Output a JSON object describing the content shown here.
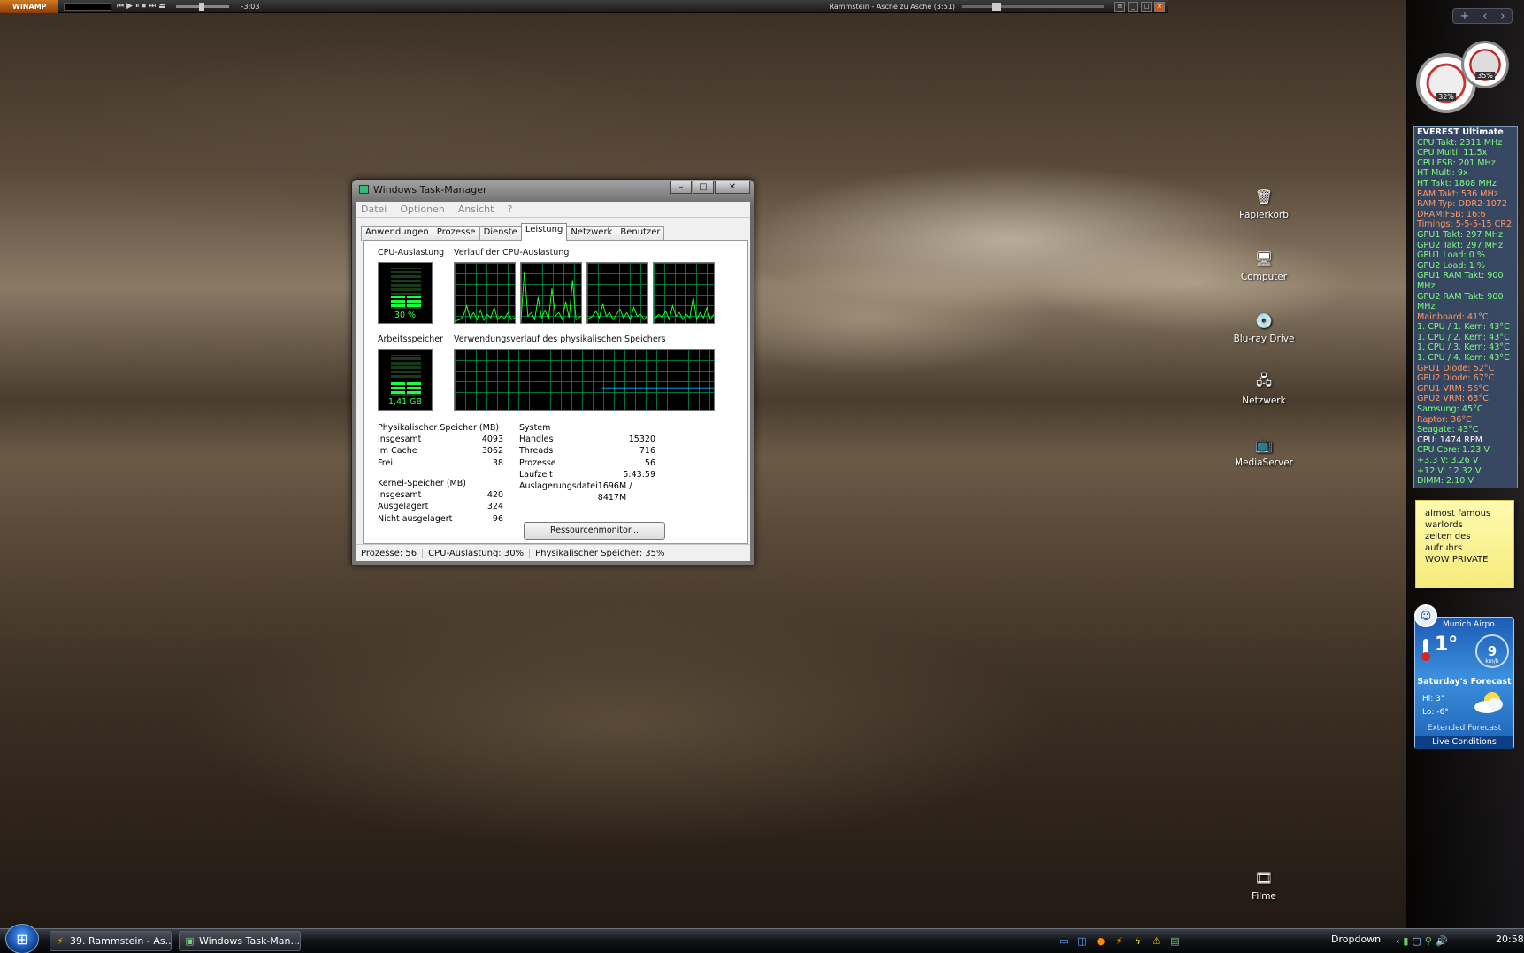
{
  "winamp": {
    "logo": "WINAMP",
    "time": "-3:03",
    "song": "Rammstein - Asche zu Asche (3:51)",
    "controls": "⏮▶⏸⏹⏭⏏"
  },
  "desktop_icons": [
    {
      "label": "Papierkorb",
      "icon": "recycle-bin-icon",
      "glyph": "🗑"
    },
    {
      "label": "Computer",
      "icon": "computer-icon",
      "glyph": "🖥"
    },
    {
      "label": "Blu-ray Drive",
      "icon": "bluray-drive-icon",
      "glyph": "💿"
    },
    {
      "label": "Netzwerk",
      "icon": "network-icon",
      "glyph": "🖧"
    },
    {
      "label": "MediaServer",
      "icon": "mediaserver-icon",
      "glyph": "📺"
    },
    {
      "label": "Filme",
      "icon": "movies-folder-icon",
      "glyph": "🎞"
    }
  ],
  "task_manager": {
    "title": "Windows Task-Manager",
    "menu": [
      "Datei",
      "Optionen",
      "Ansicht",
      "?"
    ],
    "tabs": [
      "Anwendungen",
      "Prozesse",
      "Dienste",
      "Leistung",
      "Netzwerk",
      "Benutzer"
    ],
    "active_tab": "Leistung",
    "cpu_label": "CPU-Auslastung",
    "cpu_value": "30 %",
    "cpu_fraction": 0.3,
    "cpu_history_label": "Verlauf der CPU-Auslastung",
    "mem_label": "Arbeitsspeicher",
    "mem_value": "1,41 GB",
    "mem_fraction": 0.35,
    "mem_history_label": "Verwendungsverlauf des physikalischen Speichers",
    "physical": {
      "title": "Physikalischer Speicher (MB)",
      "rows": [
        {
          "k": "Insgesamt",
          "v": "4093"
        },
        {
          "k": "Im Cache",
          "v": "3062"
        },
        {
          "k": "Frei",
          "v": "38"
        }
      ]
    },
    "kernel": {
      "title": "Kernel-Speicher (MB)",
      "rows": [
        {
          "k": "Insgesamt",
          "v": "420"
        },
        {
          "k": "Ausgelagert",
          "v": "324"
        },
        {
          "k": "Nicht ausgelagert",
          "v": "96"
        }
      ]
    },
    "system": {
      "title": "System",
      "rows": [
        {
          "k": "Handles",
          "v": "15320"
        },
        {
          "k": "Threads",
          "v": "716"
        },
        {
          "k": "Prozesse",
          "v": "56"
        },
        {
          "k": "Laufzeit",
          "v": "5:43:59"
        },
        {
          "k": "Auslagerungsdatei",
          "v": "1696M / 8417M"
        }
      ]
    },
    "resource_button": "Ressourcenmonitor...",
    "status": {
      "processes": "Prozesse: 56",
      "cpu": "CPU-Auslastung: 30%",
      "memory": "Physikalischer Speicher: 35%"
    }
  },
  "gadgets": {
    "gauge_cpu": "32%",
    "gauge_mem": "35%",
    "everest": {
      "title": "EVEREST Ultimate",
      "lines": [
        {
          "t": "CPU Takt: 2311 MHz",
          "c": "#7dff7d"
        },
        {
          "t": "CPU Multi: 11.5x",
          "c": "#7dff7d"
        },
        {
          "t": "CPU FSB: 201 MHz",
          "c": "#7dff7d"
        },
        {
          "t": "HT Multi: 9x",
          "c": "#7dff7d"
        },
        {
          "t": "HT Takt: 1808 MHz",
          "c": "#7dff7d"
        },
        {
          "t": "RAM Takt: 536 MHz",
          "c": "#ff9966"
        },
        {
          "t": "RAM Typ: DDR2-1072",
          "c": "#ff9966"
        },
        {
          "t": "DRAM:FSB: 16:6",
          "c": "#ff9966"
        },
        {
          "t": "Timings: 5-5-5-15 CR2",
          "c": "#ff9966"
        },
        {
          "t": "GPU1 Takt: 297 MHz",
          "c": "#7dff7d"
        },
        {
          "t": "GPU2 Takt: 297 MHz",
          "c": "#7dff7d"
        },
        {
          "t": "GPU1 Load: 0 %",
          "c": "#7dff7d"
        },
        {
          "t": "GPU2 Load: 1 %",
          "c": "#7dff7d"
        },
        {
          "t": "GPU1 RAM Takt: 900 MHz",
          "c": "#7dff7d"
        },
        {
          "t": "GPU2 RAM Takt: 900 MHz",
          "c": "#7dff7d"
        },
        {
          "t": "Mainboard: 41°C",
          "c": "#ff9966"
        },
        {
          "t": "1. CPU / 1. Kern: 43°C",
          "c": "#7dff7d"
        },
        {
          "t": "1. CPU / 2. Kern: 43°C",
          "c": "#7dff7d"
        },
        {
          "t": "1. CPU / 3. Kern: 43°C",
          "c": "#7dff7d"
        },
        {
          "t": "1. CPU / 4. Kern: 43°C",
          "c": "#7dff7d"
        },
        {
          "t": "GPU1 Diode: 52°C",
          "c": "#ff9966"
        },
        {
          "t": "GPU2 Diode: 67°C",
          "c": "#ff9966"
        },
        {
          "t": "GPU1 VRM: 56°C",
          "c": "#ff9966"
        },
        {
          "t": "GPU2 VRM: 63°C",
          "c": "#ff9966"
        },
        {
          "t": "Samsung: 45°C",
          "c": "#7dff7d"
        },
        {
          "t": "Raptor: 36°C",
          "c": "#ff9966"
        },
        {
          "t": "Seagate: 43°C",
          "c": "#7dff7d"
        },
        {
          "t": "CPU: 1474 RPM",
          "c": "#ffffff"
        },
        {
          "t": "CPU Core: 1.23 V",
          "c": "#7dff7d"
        },
        {
          "t": "+3.3 V: 3.26 V",
          "c": "#7dff7d"
        },
        {
          "t": "+12 V: 12.32 V",
          "c": "#7dff7d"
        },
        {
          "t": "DIMM: 2.10 V",
          "c": "#7dff7d"
        }
      ]
    },
    "note_lines": [
      "almost famous",
      "warlords",
      "zeiten des aufruhrs",
      "WOW PRIVATE"
    ],
    "weather": {
      "city": "Munich Airpo...",
      "temp": "1°",
      "wind_speed": "9",
      "wind_unit": "km/h",
      "forecast_title": "Saturday's Forecast",
      "hi": "Hi:  3°",
      "lo": "Lo: -6°",
      "extended": "Extended Forecast",
      "live": "Live Conditions"
    }
  },
  "taskbar": {
    "buttons": [
      {
        "label": "39. Rammstein - As...",
        "icon": "winamp-icon"
      },
      {
        "label": "Windows Task-Man...",
        "icon": "taskmanager-icon"
      }
    ],
    "dropdown": "Dropdown",
    "clock": "20:58"
  }
}
